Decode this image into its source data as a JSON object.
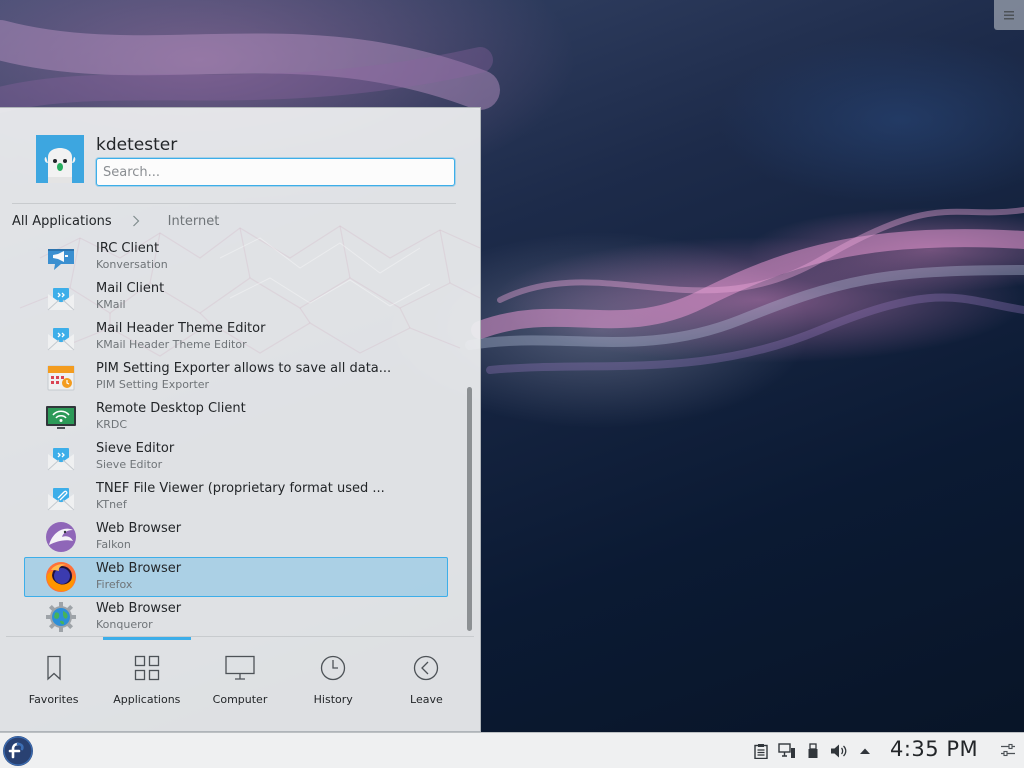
{
  "launcher": {
    "user": {
      "name": "kdetester"
    },
    "search": {
      "placeholder": "Search...",
      "value": ""
    },
    "breadcrumb": {
      "root": "All Applications",
      "current": "Internet"
    },
    "apps": [
      {
        "name": "IRC Client",
        "generic": "Konversation",
        "icon": "irc-client-icon",
        "selected": false
      },
      {
        "name": "Mail Client",
        "generic": "KMail",
        "icon": "mail-client-icon",
        "selected": false
      },
      {
        "name": "Mail Header Theme Editor",
        "generic": "KMail Header Theme Editor",
        "icon": "mail-header-theme-editor-icon",
        "selected": false
      },
      {
        "name": "PIM Setting Exporter allows to save all data...",
        "generic": "PIM Setting Exporter",
        "icon": "pim-setting-exporter-icon",
        "selected": false
      },
      {
        "name": "Remote Desktop Client",
        "generic": "KRDC",
        "icon": "remote-desktop-icon",
        "selected": false
      },
      {
        "name": "Sieve Editor",
        "generic": "Sieve Editor",
        "icon": "sieve-editor-icon",
        "selected": false
      },
      {
        "name": "TNEF File Viewer (proprietary format used ...",
        "generic": "KTnef",
        "icon": "tnef-viewer-icon",
        "selected": false
      },
      {
        "name": "Web Browser",
        "generic": "Falkon",
        "icon": "falkon-icon",
        "selected": false
      },
      {
        "name": "Web Browser",
        "generic": "Firefox",
        "icon": "firefox-icon",
        "selected": true
      },
      {
        "name": "Web Browser",
        "generic": "Konqueror",
        "icon": "konqueror-icon",
        "selected": false
      }
    ],
    "tabs": [
      {
        "label": "Favorites",
        "icon": "bookmark-icon",
        "active": false
      },
      {
        "label": "Applications",
        "icon": "applications-grid-icon",
        "active": true
      },
      {
        "label": "Computer",
        "icon": "computer-icon",
        "active": false
      },
      {
        "label": "History",
        "icon": "history-clock-icon",
        "active": false
      },
      {
        "label": "Leave",
        "icon": "leave-arrow-icon",
        "active": false
      }
    ]
  },
  "panel": {
    "clock": "4:35 PM",
    "tray_icons": [
      "clipboard-icon",
      "network-icon",
      "removable-device-icon",
      "volume-icon",
      "expand-tray-arrow-icon"
    ]
  },
  "colors": {
    "accent": "#3daee9",
    "selection_bg": "#a9cfe6",
    "launcher_bg": "#eff0f1",
    "text": "#232629",
    "secondary_text": "#6f7478"
  }
}
